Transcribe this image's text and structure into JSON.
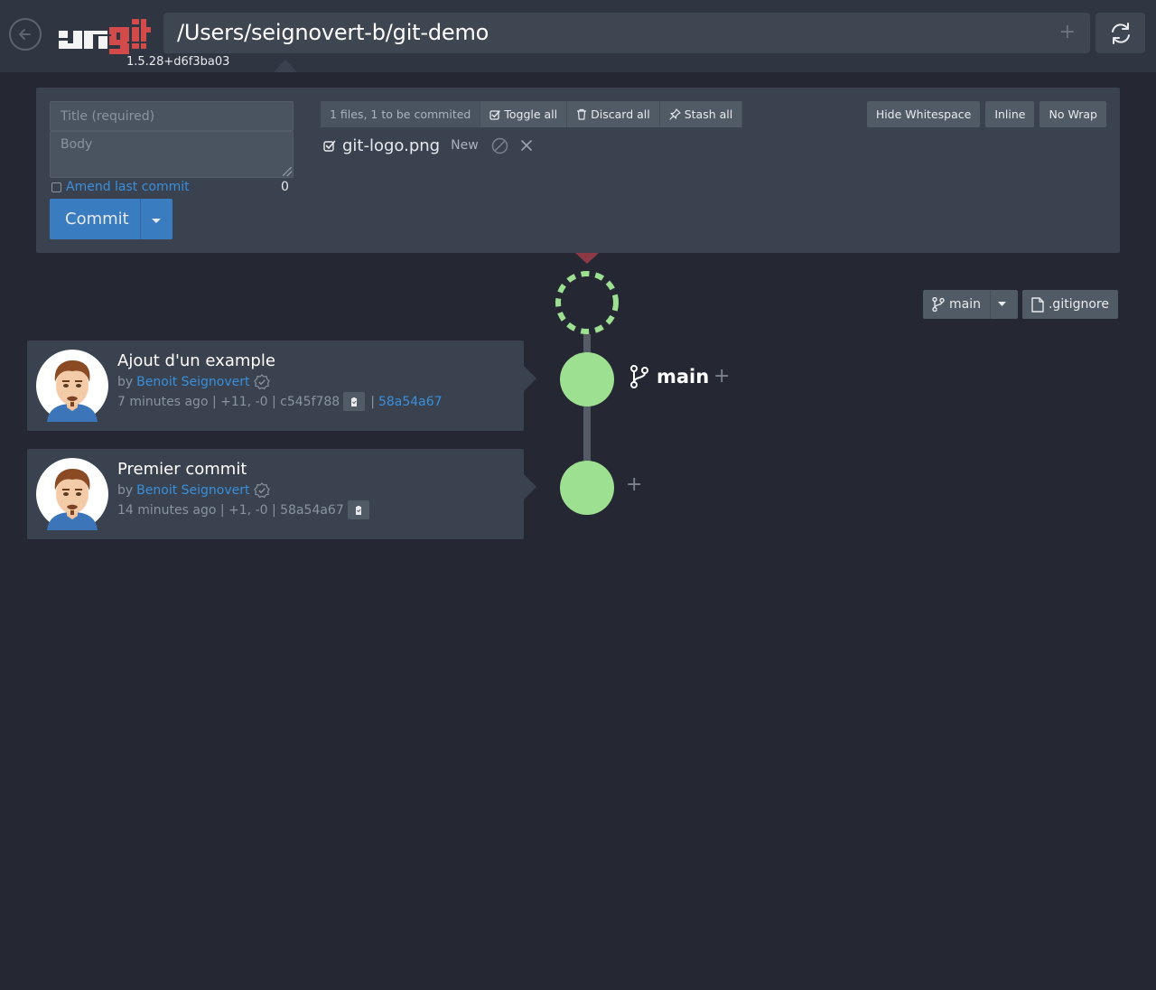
{
  "header": {
    "logo_text": "ungit",
    "version": "1.5.28+d6f3ba03",
    "path": "/Users/seignovert-b/git-demo",
    "path_plus": "+"
  },
  "staging": {
    "title_placeholder": "Title (required)",
    "body_placeholder": "Body",
    "amend_label": "Amend last commit",
    "char_count": "0",
    "commit_label": "Commit",
    "files_info": "1 files, 1 to be commited",
    "toggle_all": "Toggle all",
    "discard_all": "Discard all",
    "stash_all": "Stash all",
    "hide_whitespace": "Hide Whitespace",
    "inline": "Inline",
    "no_wrap": "No Wrap",
    "file": {
      "name": "git-logo.png",
      "status": "New"
    }
  },
  "graph": {
    "branch": "main",
    "plus": "+",
    "gitignore": ".gitignore",
    "node_color": "#9ee092"
  },
  "commits": [
    {
      "title": "Ajout d'un example",
      "by": "by",
      "author": "Benoit Seignovert",
      "meta": "7 minutes ago | +11, -0 | c545f788",
      "separator": "|",
      "parent": "58a54a67"
    },
    {
      "title": "Premier commit",
      "by": "by",
      "author": "Benoit Seignovert",
      "meta": "14 minutes ago | +1, -0 | 58a54a67"
    }
  ],
  "colors": {
    "background": "#252833",
    "panel": "#3a4250",
    "accent": "#3a7cc0",
    "link": "#3a8fdb",
    "logo_red": "#d24a4a"
  },
  "icons": [
    "back-icon",
    "refresh-icon",
    "checkbox-icon",
    "trash-icon",
    "pin-icon",
    "cancel-icon",
    "close-icon",
    "branch-icon",
    "file-icon",
    "verified-icon",
    "clipboard-icon",
    "caret-down-icon"
  ]
}
